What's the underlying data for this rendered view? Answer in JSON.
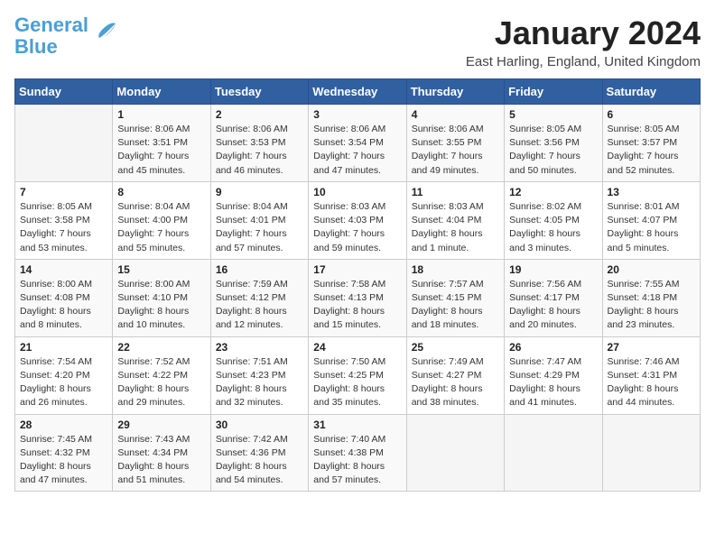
{
  "header": {
    "logo_general": "General",
    "logo_blue": "Blue",
    "month_title": "January 2024",
    "location": "East Harling, England, United Kingdom"
  },
  "days_of_week": [
    "Sunday",
    "Monday",
    "Tuesday",
    "Wednesday",
    "Thursday",
    "Friday",
    "Saturday"
  ],
  "weeks": [
    [
      {
        "day": "",
        "sunrise": "",
        "sunset": "",
        "daylight": ""
      },
      {
        "day": "1",
        "sunrise": "Sunrise: 8:06 AM",
        "sunset": "Sunset: 3:51 PM",
        "daylight": "Daylight: 7 hours and 45 minutes."
      },
      {
        "day": "2",
        "sunrise": "Sunrise: 8:06 AM",
        "sunset": "Sunset: 3:53 PM",
        "daylight": "Daylight: 7 hours and 46 minutes."
      },
      {
        "day": "3",
        "sunrise": "Sunrise: 8:06 AM",
        "sunset": "Sunset: 3:54 PM",
        "daylight": "Daylight: 7 hours and 47 minutes."
      },
      {
        "day": "4",
        "sunrise": "Sunrise: 8:06 AM",
        "sunset": "Sunset: 3:55 PM",
        "daylight": "Daylight: 7 hours and 49 minutes."
      },
      {
        "day": "5",
        "sunrise": "Sunrise: 8:05 AM",
        "sunset": "Sunset: 3:56 PM",
        "daylight": "Daylight: 7 hours and 50 minutes."
      },
      {
        "day": "6",
        "sunrise": "Sunrise: 8:05 AM",
        "sunset": "Sunset: 3:57 PM",
        "daylight": "Daylight: 7 hours and 52 minutes."
      }
    ],
    [
      {
        "day": "7",
        "sunrise": "Sunrise: 8:05 AM",
        "sunset": "Sunset: 3:58 PM",
        "daylight": "Daylight: 7 hours and 53 minutes."
      },
      {
        "day": "8",
        "sunrise": "Sunrise: 8:04 AM",
        "sunset": "Sunset: 4:00 PM",
        "daylight": "Daylight: 7 hours and 55 minutes."
      },
      {
        "day": "9",
        "sunrise": "Sunrise: 8:04 AM",
        "sunset": "Sunset: 4:01 PM",
        "daylight": "Daylight: 7 hours and 57 minutes."
      },
      {
        "day": "10",
        "sunrise": "Sunrise: 8:03 AM",
        "sunset": "Sunset: 4:03 PM",
        "daylight": "Daylight: 7 hours and 59 minutes."
      },
      {
        "day": "11",
        "sunrise": "Sunrise: 8:03 AM",
        "sunset": "Sunset: 4:04 PM",
        "daylight": "Daylight: 8 hours and 1 minute."
      },
      {
        "day": "12",
        "sunrise": "Sunrise: 8:02 AM",
        "sunset": "Sunset: 4:05 PM",
        "daylight": "Daylight: 8 hours and 3 minutes."
      },
      {
        "day": "13",
        "sunrise": "Sunrise: 8:01 AM",
        "sunset": "Sunset: 4:07 PM",
        "daylight": "Daylight: 8 hours and 5 minutes."
      }
    ],
    [
      {
        "day": "14",
        "sunrise": "Sunrise: 8:00 AM",
        "sunset": "Sunset: 4:08 PM",
        "daylight": "Daylight: 8 hours and 8 minutes."
      },
      {
        "day": "15",
        "sunrise": "Sunrise: 8:00 AM",
        "sunset": "Sunset: 4:10 PM",
        "daylight": "Daylight: 8 hours and 10 minutes."
      },
      {
        "day": "16",
        "sunrise": "Sunrise: 7:59 AM",
        "sunset": "Sunset: 4:12 PM",
        "daylight": "Daylight: 8 hours and 12 minutes."
      },
      {
        "day": "17",
        "sunrise": "Sunrise: 7:58 AM",
        "sunset": "Sunset: 4:13 PM",
        "daylight": "Daylight: 8 hours and 15 minutes."
      },
      {
        "day": "18",
        "sunrise": "Sunrise: 7:57 AM",
        "sunset": "Sunset: 4:15 PM",
        "daylight": "Daylight: 8 hours and 18 minutes."
      },
      {
        "day": "19",
        "sunrise": "Sunrise: 7:56 AM",
        "sunset": "Sunset: 4:17 PM",
        "daylight": "Daylight: 8 hours and 20 minutes."
      },
      {
        "day": "20",
        "sunrise": "Sunrise: 7:55 AM",
        "sunset": "Sunset: 4:18 PM",
        "daylight": "Daylight: 8 hours and 23 minutes."
      }
    ],
    [
      {
        "day": "21",
        "sunrise": "Sunrise: 7:54 AM",
        "sunset": "Sunset: 4:20 PM",
        "daylight": "Daylight: 8 hours and 26 minutes."
      },
      {
        "day": "22",
        "sunrise": "Sunrise: 7:52 AM",
        "sunset": "Sunset: 4:22 PM",
        "daylight": "Daylight: 8 hours and 29 minutes."
      },
      {
        "day": "23",
        "sunrise": "Sunrise: 7:51 AM",
        "sunset": "Sunset: 4:23 PM",
        "daylight": "Daylight: 8 hours and 32 minutes."
      },
      {
        "day": "24",
        "sunrise": "Sunrise: 7:50 AM",
        "sunset": "Sunset: 4:25 PM",
        "daylight": "Daylight: 8 hours and 35 minutes."
      },
      {
        "day": "25",
        "sunrise": "Sunrise: 7:49 AM",
        "sunset": "Sunset: 4:27 PM",
        "daylight": "Daylight: 8 hours and 38 minutes."
      },
      {
        "day": "26",
        "sunrise": "Sunrise: 7:47 AM",
        "sunset": "Sunset: 4:29 PM",
        "daylight": "Daylight: 8 hours and 41 minutes."
      },
      {
        "day": "27",
        "sunrise": "Sunrise: 7:46 AM",
        "sunset": "Sunset: 4:31 PM",
        "daylight": "Daylight: 8 hours and 44 minutes."
      }
    ],
    [
      {
        "day": "28",
        "sunrise": "Sunrise: 7:45 AM",
        "sunset": "Sunset: 4:32 PM",
        "daylight": "Daylight: 8 hours and 47 minutes."
      },
      {
        "day": "29",
        "sunrise": "Sunrise: 7:43 AM",
        "sunset": "Sunset: 4:34 PM",
        "daylight": "Daylight: 8 hours and 51 minutes."
      },
      {
        "day": "30",
        "sunrise": "Sunrise: 7:42 AM",
        "sunset": "Sunset: 4:36 PM",
        "daylight": "Daylight: 8 hours and 54 minutes."
      },
      {
        "day": "31",
        "sunrise": "Sunrise: 7:40 AM",
        "sunset": "Sunset: 4:38 PM",
        "daylight": "Daylight: 8 hours and 57 minutes."
      },
      {
        "day": "",
        "sunrise": "",
        "sunset": "",
        "daylight": ""
      },
      {
        "day": "",
        "sunrise": "",
        "sunset": "",
        "daylight": ""
      },
      {
        "day": "",
        "sunrise": "",
        "sunset": "",
        "daylight": ""
      }
    ]
  ]
}
